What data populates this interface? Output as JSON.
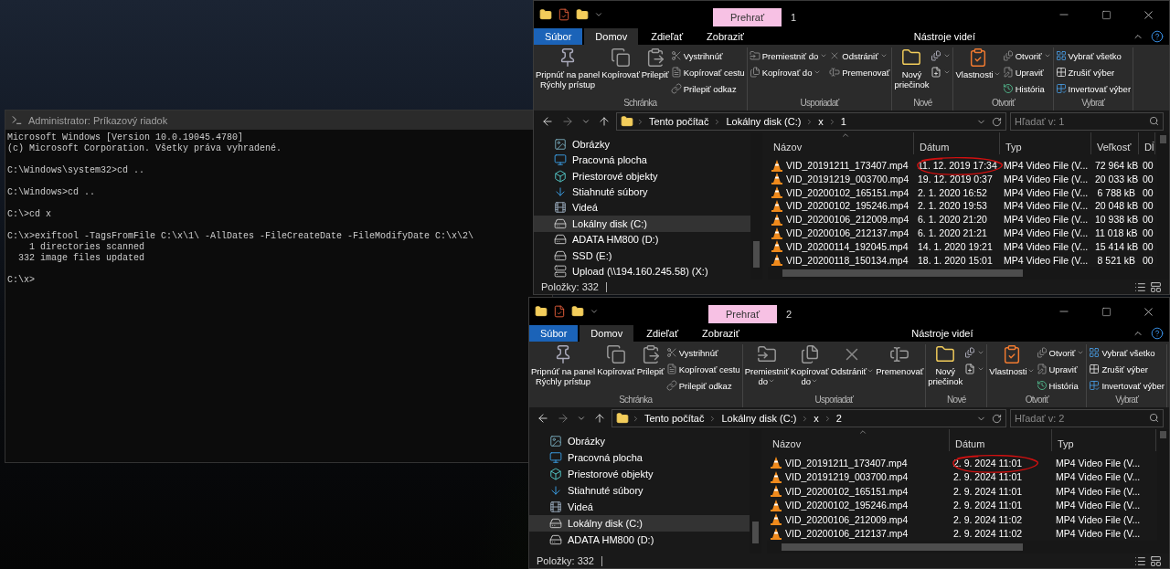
{
  "console": {
    "title": "Administrator: Príkazový riadok",
    "blocks": [
      [
        "Microsoft Windows [Version 10.0.19045.4780]",
        "(c) Microsoft Corporation. Všetky práva vyhradené."
      ],
      [
        "C:\\Windows\\system32>cd .."
      ],
      [
        "C:\\Windows>cd .."
      ],
      [
        "C:\\>cd x"
      ],
      [
        "C:\\x>exiftool -TagsFromFile C:\\x\\1\\ -AllDates -FileCreateDate -FileModifyDate C:\\x\\2\\",
        "    1 directories scanned",
        "  332 image files updated"
      ],
      [
        "C:\\x>"
      ]
    ]
  },
  "explorers": [
    {
      "context_label": "Prehrať",
      "title": "1",
      "tabs": [
        {
          "label": "Súbor",
          "kind": "file",
          "selected": false
        },
        {
          "label": "Domov",
          "kind": "normal",
          "selected": true
        },
        {
          "label": "Zdieľať",
          "kind": "normal",
          "selected": false
        },
        {
          "label": "Zobraziť",
          "kind": "normal",
          "selected": false
        },
        {
          "label": "Nástroje videí",
          "kind": "context",
          "selected": false
        }
      ],
      "ribbon": [
        {
          "label": "Schránka",
          "columns": [
            [
              {
                "kind": "large",
                "label": "Pripnúť na panel\nRýchly prístup",
                "dropdown": false
              }
            ],
            [
              {
                "kind": "large",
                "label": "Kopírovať",
                "dropdown": false
              }
            ],
            [
              {
                "kind": "large",
                "label": "Prilepiť",
                "dropdown": false
              }
            ],
            [
              {
                "kind": "small",
                "label": "Vystrihnúť",
                "dropdown": false
              },
              {
                "kind": "small",
                "label": "Kopírovať cestu",
                "dropdown": false
              },
              {
                "kind": "small",
                "label": "Prilepiť odkaz",
                "dropdown": false
              }
            ]
          ]
        },
        {
          "label": "Usporiadať",
          "columns": [
            [
              {
                "kind": "small",
                "label": "Premiestniť do",
                "dropdown": true
              },
              {
                "kind": "small",
                "label": "Kopírovať do",
                "dropdown": true
              }
            ],
            [
              {
                "kind": "small",
                "label": "Odstrániť",
                "dropdown": true
              },
              {
                "kind": "small",
                "label": "Premenovať",
                "dropdown": false
              }
            ]
          ]
        },
        {
          "label": "Nové",
          "columns": [
            [
              {
                "kind": "large",
                "label": "Nový\npriečinok",
                "dropdown": false
              }
            ],
            [
              {
                "kind": "icon",
                "dropdown": true
              },
              {
                "kind": "icon",
                "dropdown": true
              }
            ]
          ]
        },
        {
          "label": "Otvoriť",
          "columns": [
            [
              {
                "kind": "large",
                "label": "Vlastnosti",
                "dropdown": true
              }
            ],
            [
              {
                "kind": "small",
                "label": "Otvoriť",
                "dropdown": true
              },
              {
                "kind": "small",
                "label": "Upraviť",
                "dropdown": false
              },
              {
                "kind": "small",
                "label": "História",
                "dropdown": false
              }
            ]
          ]
        },
        {
          "label": "Vybrať",
          "columns": [
            [
              {
                "kind": "small",
                "label": "Vybrať všetko",
                "dropdown": false
              },
              {
                "kind": "small",
                "label": "Zrušiť výber",
                "dropdown": false
              },
              {
                "kind": "small",
                "label": "Invertovať výber",
                "dropdown": false
              }
            ]
          ]
        }
      ],
      "path": [
        "Tento počítač",
        "Lokálny disk (C:)",
        "x",
        "1"
      ],
      "search": {
        "placeholder": "Hľadať v: 1"
      },
      "nav": [
        {
          "kind": "pictures",
          "label": "Obrázky",
          "selected": false
        },
        {
          "kind": "desktop",
          "label": "Pracovná plocha",
          "selected": false
        },
        {
          "kind": "objects",
          "label": "Priestorové objekty",
          "selected": false
        },
        {
          "kind": "downloads",
          "label": "Stiahnuté súbory",
          "selected": false
        },
        {
          "kind": "videos",
          "label": "Videá",
          "selected": false
        },
        {
          "kind": "drive",
          "label": "Lokálny disk (C:)",
          "selected": true
        },
        {
          "kind": "drive",
          "label": "ADATA HM800 (D:)",
          "selected": false
        },
        {
          "kind": "drive",
          "label": "SSD (E:)",
          "selected": false
        },
        {
          "kind": "network",
          "label": "Upload (\\\\194.160.245.58) (X:)",
          "selected": false
        }
      ],
      "columns": [
        "Názov",
        "Dátum",
        "Typ",
        "Veľkosť",
        "Dĺ"
      ],
      "rows": [
        {
          "cells": [
            "VID_20191211_173407.mp4",
            "11. 12. 2019 17:34",
            "MP4 Video File (V...",
            "72 964 kB",
            "00"
          ],
          "circled": true
        },
        {
          "cells": [
            "VID_20191219_003700.mp4",
            "19. 12. 2019 0:37",
            "MP4 Video File (V...",
            "20 033 kB",
            "00"
          ],
          "circled": false
        },
        {
          "cells": [
            "VID_20200102_165151.mp4",
            "2. 1. 2020 16:52",
            "MP4 Video File (V...",
            "6 788 kB",
            "00"
          ],
          "circled": false
        },
        {
          "cells": [
            "VID_20200102_195246.mp4",
            "2. 1. 2020 19:53",
            "MP4 Video File (V...",
            "20 048 kB",
            "00"
          ],
          "circled": false
        },
        {
          "cells": [
            "VID_20200106_212009.mp4",
            "6. 1. 2020 21:20",
            "MP4 Video File (V...",
            "10 938 kB",
            "00"
          ],
          "circled": false
        },
        {
          "cells": [
            "VID_20200106_212137.mp4",
            "6. 1. 2020 21:21",
            "MP4 Video File (V...",
            "11 018 kB",
            "00"
          ],
          "circled": false
        },
        {
          "cells": [
            "VID_20200114_192045.mp4",
            "14. 1. 2020 19:21",
            "MP4 Video File (V...",
            "15 414 kB",
            "00"
          ],
          "circled": false
        },
        {
          "cells": [
            "VID_20200118_150134.mp4",
            "18. 1. 2020 15:01",
            "MP4 Video File (V...",
            "8 521 kB",
            "00"
          ],
          "circled": false
        }
      ],
      "status": "Položky: 332"
    },
    {
      "context_label": "Prehrať",
      "title": "2",
      "tabs": [
        {
          "label": "Súbor",
          "kind": "file",
          "selected": false
        },
        {
          "label": "Domov",
          "kind": "normal",
          "selected": true
        },
        {
          "label": "Zdieľať",
          "kind": "normal",
          "selected": false
        },
        {
          "label": "Zobraziť",
          "kind": "normal",
          "selected": false
        },
        {
          "label": "Nástroje videí",
          "kind": "context",
          "selected": false
        }
      ],
      "ribbon": [
        {
          "label": "Schránka",
          "columns": [
            [
              {
                "kind": "large",
                "label": "Pripnúť na panel\nRýchly prístup",
                "dropdown": false
              }
            ],
            [
              {
                "kind": "large",
                "label": "Kopírovať",
                "dropdown": false
              }
            ],
            [
              {
                "kind": "large",
                "label": "Prilepiť",
                "dropdown": false
              }
            ],
            [
              {
                "kind": "small",
                "label": "Vystrihnúť",
                "dropdown": false
              },
              {
                "kind": "small",
                "label": "Kopírovať cestu",
                "dropdown": false
              },
              {
                "kind": "small",
                "label": "Prilepiť odkaz",
                "dropdown": false
              }
            ]
          ]
        },
        {
          "label": "Usporiadať",
          "columns": [
            [
              {
                "kind": "large",
                "label": "Premiestniť\ndo",
                "dropdown": true
              }
            ],
            [
              {
                "kind": "large",
                "label": "Kopírovať\ndo",
                "dropdown": true
              }
            ],
            [
              {
                "kind": "large",
                "label": "Odstrániť",
                "dropdown": true
              }
            ],
            [
              {
                "kind": "large",
                "label": "Premenovať",
                "dropdown": false
              }
            ]
          ]
        },
        {
          "label": "Nové",
          "columns": [
            [
              {
                "kind": "large",
                "label": "Nový\npriečinok",
                "dropdown": false
              }
            ],
            [
              {
                "kind": "icon",
                "dropdown": true
              },
              {
                "kind": "icon",
                "dropdown": true
              }
            ]
          ]
        },
        {
          "label": "Otvoriť",
          "columns": [
            [
              {
                "kind": "large",
                "label": "Vlastnosti",
                "dropdown": true
              }
            ],
            [
              {
                "kind": "small",
                "label": "Otvoriť",
                "dropdown": true
              },
              {
                "kind": "small",
                "label": "Upraviť",
                "dropdown": false
              },
              {
                "kind": "small",
                "label": "História",
                "dropdown": false
              }
            ]
          ]
        },
        {
          "label": "Vybrať",
          "columns": [
            [
              {
                "kind": "small",
                "label": "Vybrať všetko",
                "dropdown": false
              },
              {
                "kind": "small",
                "label": "Zrušiť výber",
                "dropdown": false
              },
              {
                "kind": "small",
                "label": "Invertovať výber",
                "dropdown": false
              }
            ]
          ]
        }
      ],
      "path": [
        "Tento počítač",
        "Lokálny disk (C:)",
        "x",
        "2"
      ],
      "search": {
        "placeholder": "Hľadať v: 2"
      },
      "nav": [
        {
          "kind": "pictures",
          "label": "Obrázky",
          "selected": false
        },
        {
          "kind": "desktop",
          "label": "Pracovná plocha",
          "selected": false
        },
        {
          "kind": "objects",
          "label": "Priestorové objekty",
          "selected": false
        },
        {
          "kind": "downloads",
          "label": "Stiahnuté súbory",
          "selected": false
        },
        {
          "kind": "videos",
          "label": "Videá",
          "selected": false
        },
        {
          "kind": "drive",
          "label": "Lokálny disk (C:)",
          "selected": true
        },
        {
          "kind": "drive",
          "label": "ADATA HM800 (D:)",
          "selected": false
        }
      ],
      "columns": [
        "Názov",
        "Dátum",
        "Typ"
      ],
      "rows": [
        {
          "cells": [
            "VID_20191211_173407.mp4",
            "2. 9. 2024 11:01",
            "MP4 Video File (V..."
          ],
          "circled": true
        },
        {
          "cells": [
            "VID_20191219_003700.mp4",
            "2. 9. 2024 11:01",
            "MP4 Video File (V..."
          ],
          "circled": false
        },
        {
          "cells": [
            "VID_20200102_165151.mp4",
            "2. 9. 2024 11:01",
            "MP4 Video File (V..."
          ],
          "circled": false
        },
        {
          "cells": [
            "VID_20200102_195246.mp4",
            "2. 9. 2024 11:01",
            "MP4 Video File (V..."
          ],
          "circled": false
        },
        {
          "cells": [
            "VID_20200106_212009.mp4",
            "2. 9. 2024 11:02",
            "MP4 Video File (V..."
          ],
          "circled": false
        },
        {
          "cells": [
            "VID_20200106_212137.mp4",
            "2. 9. 2024 11:02",
            "MP4 Video File (V..."
          ],
          "circled": false
        }
      ],
      "status": "Položky: 332"
    }
  ]
}
